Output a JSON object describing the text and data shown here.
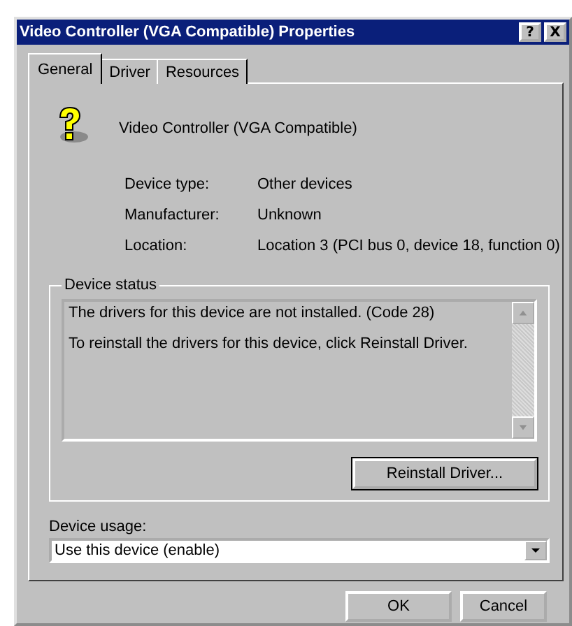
{
  "window": {
    "title": "Video Controller (VGA Compatible) Properties",
    "help_button": "?",
    "close_button": "X"
  },
  "tabs": [
    {
      "label": "General",
      "selected": true
    },
    {
      "label": "Driver",
      "selected": false
    },
    {
      "label": "Resources",
      "selected": false
    }
  ],
  "device": {
    "name": "Video Controller (VGA Compatible)",
    "properties": [
      {
        "label": "Device type:",
        "value": "Other devices"
      },
      {
        "label": "Manufacturer:",
        "value": "Unknown"
      },
      {
        "label": "Location:",
        "value": "Location 3 (PCI bus 0, device 18, function 0)"
      }
    ]
  },
  "device_status": {
    "title": "Device status",
    "lines": [
      "The drivers for this device are not installed. (Code 28)",
      "To reinstall the drivers for this device, click Reinstall Driver."
    ],
    "button": "Reinstall Driver..."
  },
  "device_usage": {
    "label": "Device usage:",
    "value": "Use this device (enable)"
  },
  "buttons": [
    "OK",
    "Cancel"
  ]
}
